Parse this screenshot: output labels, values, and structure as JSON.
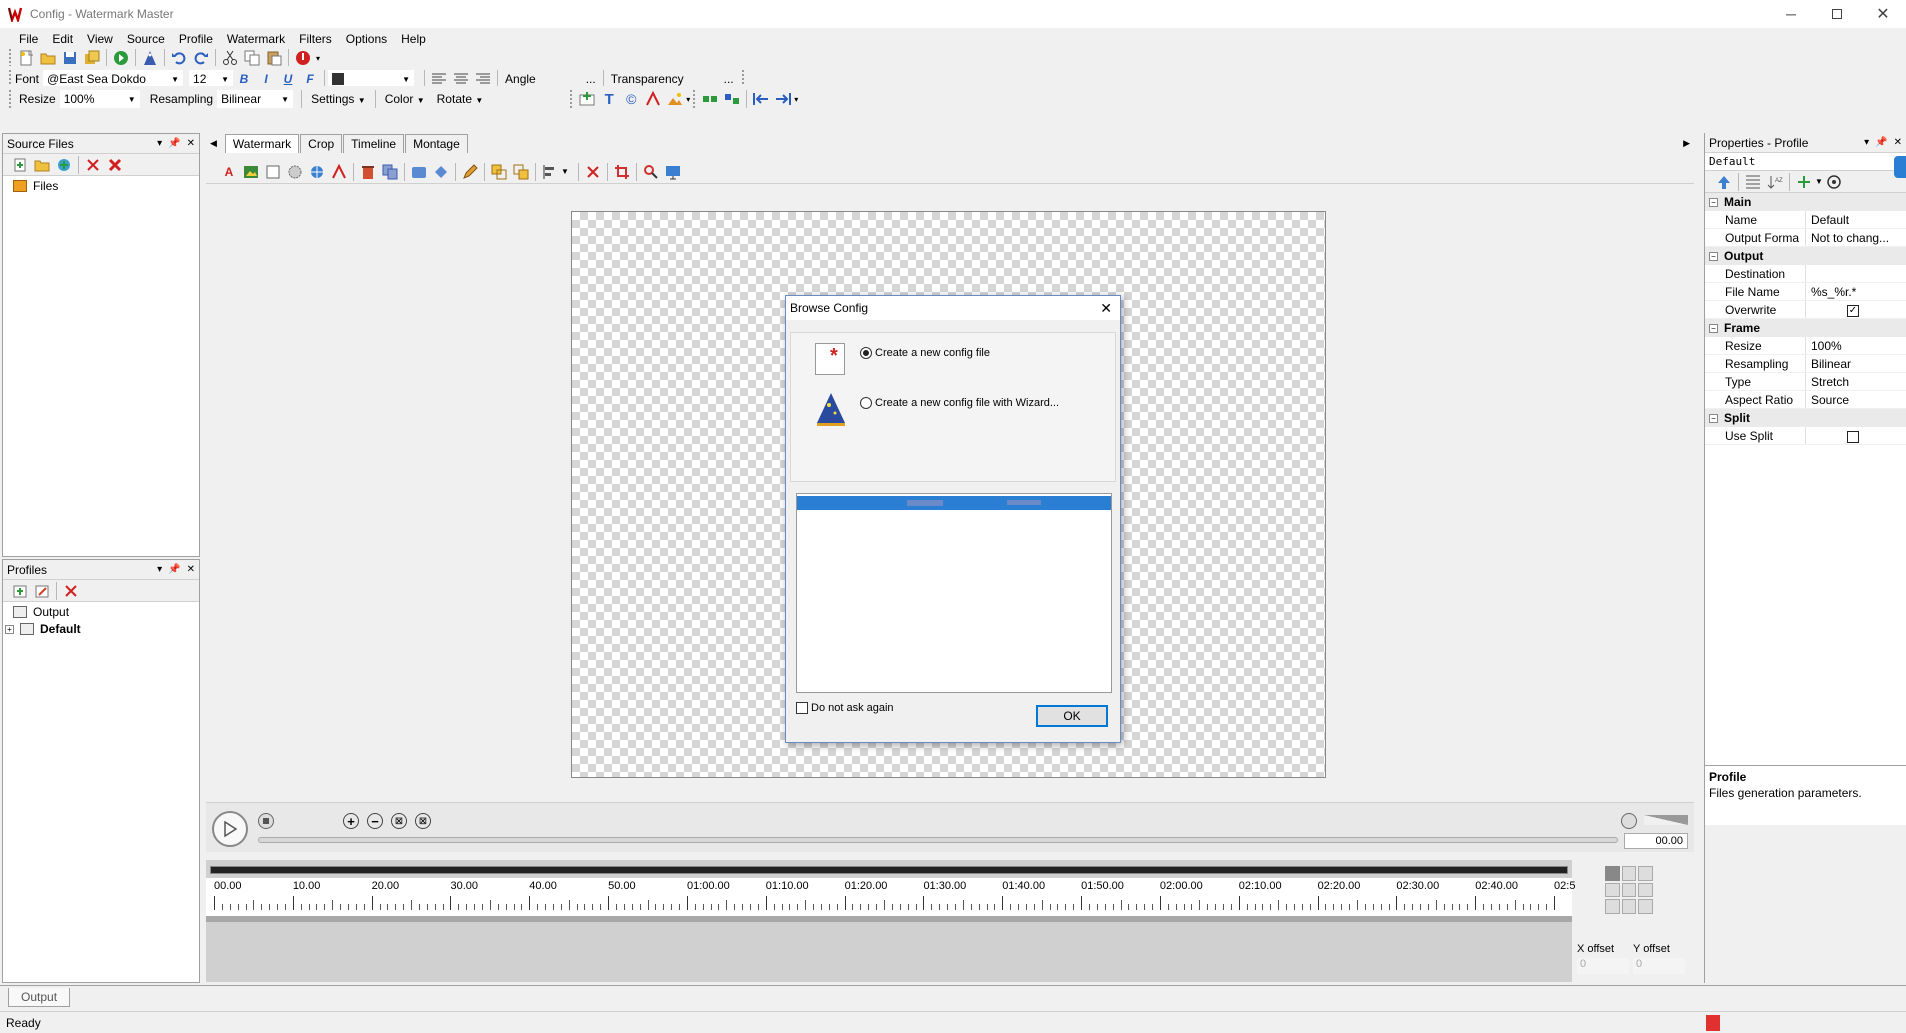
{
  "window": {
    "title": "Config - Watermark Master"
  },
  "menu": [
    "File",
    "Edit",
    "View",
    "Source",
    "Profile",
    "Watermark",
    "Filters",
    "Options",
    "Help"
  ],
  "fontbar": {
    "font_label": "Font",
    "font_value": "@East Sea Dokdo",
    "size_value": "12",
    "angle_label": "Angle",
    "angle_dots": "...",
    "transparency_label": "Transparency",
    "transparency_dots": "..."
  },
  "resizebar": {
    "resize_label": "Resize",
    "resize_value": "100%",
    "resampling_label": "Resampling",
    "resampling_value": "Bilinear",
    "settings_label": "Settings",
    "color_label": "Color",
    "rotate_label": "Rotate"
  },
  "source_files": {
    "title": "Source Files",
    "tree_root": "Files"
  },
  "profiles": {
    "title": "Profiles",
    "items": [
      "Output",
      "Default"
    ]
  },
  "tabs": [
    "Watermark",
    "Crop",
    "Timeline",
    "Montage"
  ],
  "player": {
    "time": "00.00"
  },
  "timeline": {
    "ticks": [
      "00.00",
      "10.00",
      "20.00",
      "30.00",
      "40.00",
      "50.00",
      "01:00.00",
      "01:10.00",
      "01:20.00",
      "01:30.00",
      "01:40.00",
      "01:50.00",
      "02:00.00",
      "02:10.00",
      "02:20.00",
      "02:30.00",
      "02:40.00",
      "02:5"
    ]
  },
  "offsets": {
    "x_label": "X offset",
    "x_value": "0",
    "y_label": "Y offset",
    "y_value": "0"
  },
  "properties": {
    "title": "Properties - Profile",
    "profile_name": "Default",
    "categories": [
      {
        "name": "Main",
        "rows": [
          {
            "name": "Name",
            "value": "Default"
          },
          {
            "name": "Output Forma",
            "value": "Not to chang..."
          }
        ]
      },
      {
        "name": "Output",
        "rows": [
          {
            "name": "Destination",
            "value": ""
          },
          {
            "name": "File Name",
            "value": "%s_%r.*"
          },
          {
            "name": "Overwrite",
            "value": "",
            "checkbox": true,
            "checked": true
          }
        ]
      },
      {
        "name": "Frame",
        "rows": [
          {
            "name": "Resize",
            "value": "100%"
          },
          {
            "name": "Resampling",
            "value": "Bilinear"
          },
          {
            "name": "Type",
            "value": "Stretch"
          },
          {
            "name": "Aspect Ratio",
            "value": "Source"
          }
        ]
      },
      {
        "name": "Split",
        "rows": [
          {
            "name": "Use Split",
            "value": "",
            "checkbox": true,
            "checked": false
          }
        ]
      }
    ],
    "desc_title": "Profile",
    "desc_text": "Files generation parameters."
  },
  "dialog": {
    "title": "Browse Config",
    "option_new": "Create a new config file",
    "option_wizard": "Create a new config file with Wizard...",
    "do_not_ask": "Do not ask again",
    "ok": "OK"
  },
  "bottom_tab": "Output",
  "status": "Ready",
  "colors": {
    "accent": "#0078d7",
    "selection": "#2a7fd4",
    "dialog_border": "#6a8cc4"
  }
}
